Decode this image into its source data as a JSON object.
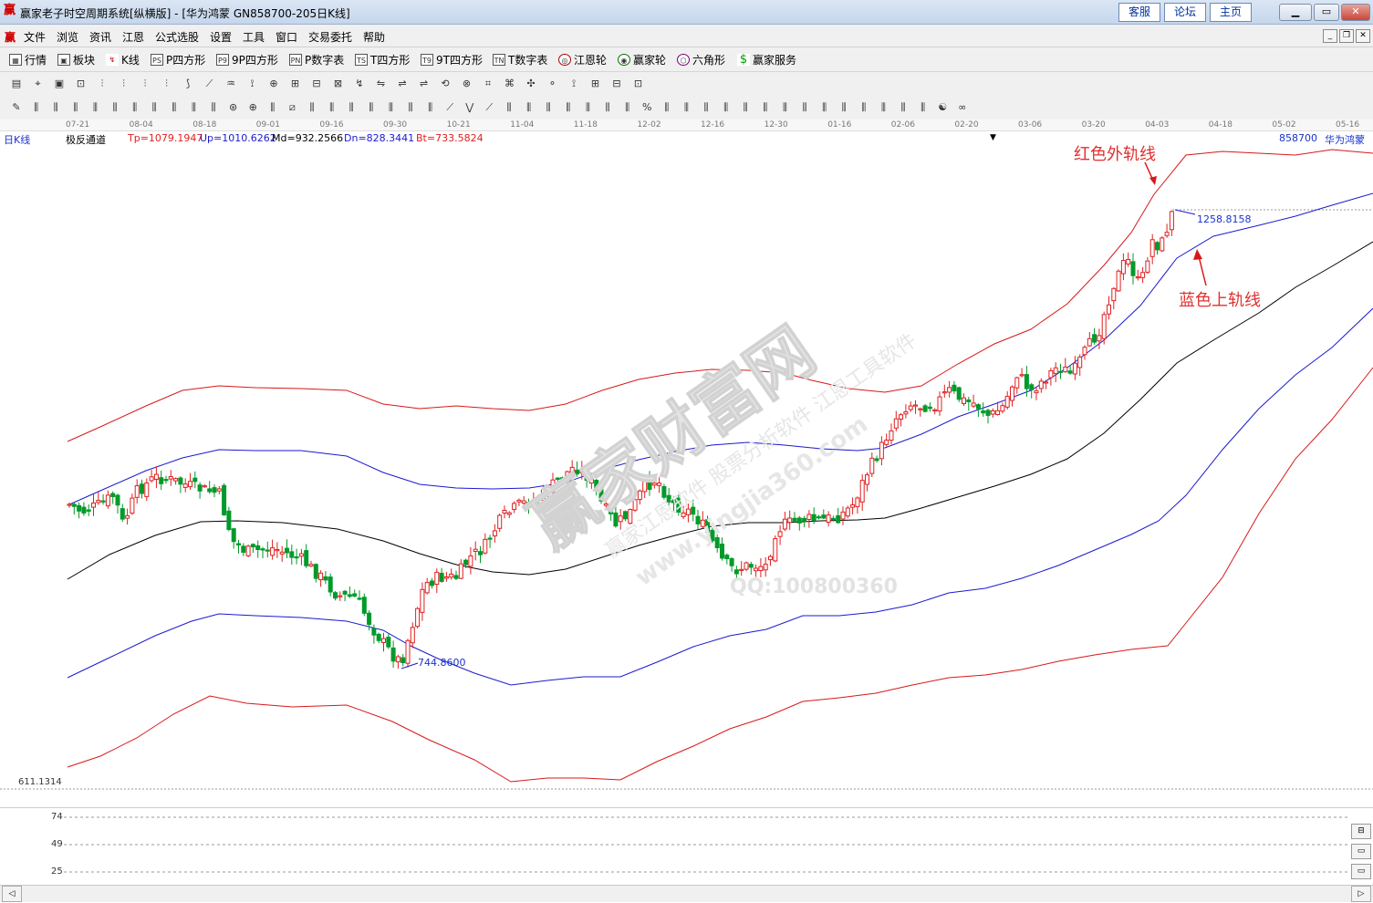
{
  "window": {
    "title": "赢家老子时空周期系统[纵横版] - [华为鸿蒙   GN858700-205日K线]",
    "links": [
      "客服",
      "论坛",
      "主页"
    ]
  },
  "menu": {
    "items": [
      "文件",
      "浏览",
      "资讯",
      "江恩",
      "公式选股",
      "设置",
      "工具",
      "窗口",
      "交易委托",
      "帮助"
    ]
  },
  "toolbar1": {
    "items": [
      {
        "label": "行情",
        "icon": "grid-icon"
      },
      {
        "label": "板块",
        "icon": "block-icon"
      },
      {
        "label": "K线",
        "icon": "kline-icon"
      },
      {
        "label": "P四方形",
        "icon": "ps-icon",
        "code": "PS"
      },
      {
        "label": "9P四方形",
        "icon": "p9-icon",
        "code": "P9"
      },
      {
        "label": "P数字表",
        "icon": "pn-icon",
        "code": "PN"
      },
      {
        "label": "T四方形",
        "icon": "ts-icon",
        "code": "TS"
      },
      {
        "label": "9T四方形",
        "icon": "t9-icon",
        "code": "T9"
      },
      {
        "label": "T数字表",
        "icon": "tn-icon",
        "code": "TN"
      },
      {
        "label": "江恩轮",
        "icon": "gann-wheel-icon"
      },
      {
        "label": "赢家轮",
        "icon": "winner-wheel-icon"
      },
      {
        "label": "六角形",
        "icon": "hexagon-icon"
      },
      {
        "label": "赢家服务",
        "icon": "dollar-icon"
      }
    ]
  },
  "date_axis": [
    "07-21",
    "08-04",
    "08-18",
    "09-01",
    "09-16",
    "09-30",
    "10-21",
    "11-04",
    "11-18",
    "12-02",
    "12-16",
    "12-30",
    "01-16",
    "02-06",
    "02-20",
    "03-06",
    "03-20",
    "04-03",
    "04-18",
    "05-02",
    "05-16"
  ],
  "indicator": {
    "period": "日K线",
    "name": "极反通道",
    "tp": "Tp=1079.1947",
    "up": "Up=1010.6262",
    "md": "Md=932.2566",
    "dn": "Dn=828.3441",
    "bt": "Bt=733.5824",
    "code": "858700",
    "stock": "华为鸿蒙"
  },
  "chart_labels": {
    "high_price": "1258.8158",
    "low_price": "744.8600",
    "axis_min": "611.1314"
  },
  "annotations": {
    "red_outer": "红色外轨线",
    "blue_upper": "蓝色上轨线"
  },
  "lower_pane": {
    "levels": [
      "74",
      "49",
      "25"
    ]
  },
  "watermark": {
    "line1": "赢家财富网",
    "line2": "赢家江恩软件 股票分析软件 江恩工具软件",
    "line3": "www.yingjia360.com",
    "line4": "QQ:100800360"
  },
  "colors": {
    "up": "#e02020",
    "down": "#009a2a",
    "red_band": "#d81818",
    "blue_band": "#1a1ad0",
    "mid_line": "#000000"
  }
}
